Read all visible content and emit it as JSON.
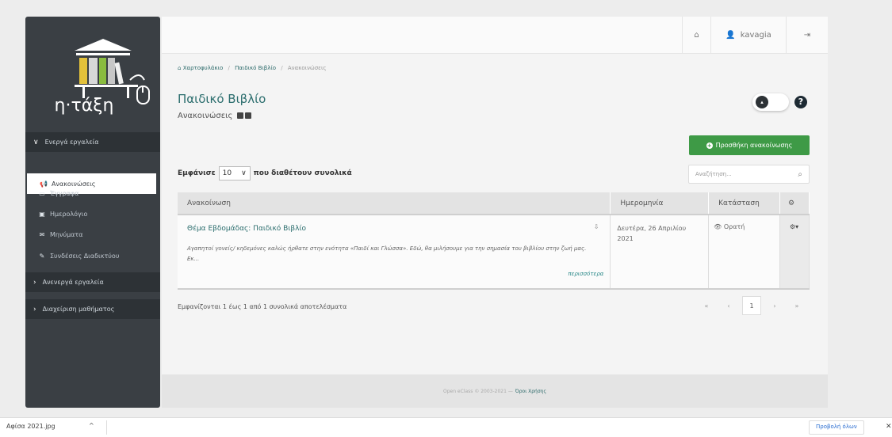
{
  "sidebar": {
    "logo_text": "η·τάξη",
    "sections": [
      {
        "label": "Ενεργά εργαλεία",
        "chevron": "chevron-down-icon"
      },
      {
        "label": "Ανενεργά εργαλεία",
        "chevron": "chevron-right-icon"
      },
      {
        "label": "Διαχείριση μαθήματος",
        "chevron": "chevron-right-icon"
      }
    ],
    "items": [
      {
        "label": "Ανακοινώσεις",
        "icon": "megaphone-icon",
        "active": true
      },
      {
        "label": "Έγγραφα",
        "icon": "folder-icon"
      },
      {
        "label": "Ημερολόγιο",
        "icon": "calendar-icon"
      },
      {
        "label": "Μηνύματα",
        "icon": "envelope-icon"
      },
      {
        "label": "Συνδέσεις Διαδικτύου",
        "icon": "link-icon"
      }
    ]
  },
  "topbar": {
    "user": "kavagia"
  },
  "breadcrumb": [
    "Χαρτοφυλάκιο",
    "Παιδικό Βιβλίο",
    "Ανακοινώσεις"
  ],
  "page": {
    "title": "Παιδικό Βιβλίο",
    "subtitle": "Ανακοινώσεις"
  },
  "add_button": "Προσθήκη ανακοίνωσης",
  "length_control": {
    "prefix": "Εμφάνισε",
    "value": "10",
    "suffix": "που διαθέτουν συνολικά"
  },
  "search": {
    "placeholder": "Αναζήτηση..."
  },
  "table": {
    "headers": [
      "Ανακοίνωση",
      "Ημερομηνία",
      "Κατάσταση"
    ],
    "rows": [
      {
        "title": "Θέμα Εβδομάδας: Παιδικό Βιβλίο",
        "excerpt": "Αγαπητοί γονείς/ κηδεμόνες καλώς ήρθατε στην ενότητα «Παιδί και Γλώσσα». Εδώ, θα μιλήσουμε για την σημασία του βιβλίου στην ζωή μας. Εκ...",
        "more": "περισσότερα",
        "date": "Δευτέρα, 26 Απριλίου 2021",
        "status": "Ορατή"
      }
    ]
  },
  "info": "Εμφανίζονται 1 έως 1 από 1 συνολικά αποτελέσματα",
  "pagination": {
    "first": "«",
    "prev": "‹",
    "current": "1",
    "next": "›",
    "last": "»"
  },
  "footer": {
    "copyright": "Open eClass © 2003-2021 —",
    "terms": "Όροι Χρήσης"
  },
  "download_bar": {
    "file": "Αφίσα 2021.jpg",
    "chevron": "^",
    "show_all": "Προβολή όλων"
  },
  "colors": {
    "sidebar": "#3a3f44",
    "accent": "#2c6e6e",
    "add": "#3e9a46"
  }
}
